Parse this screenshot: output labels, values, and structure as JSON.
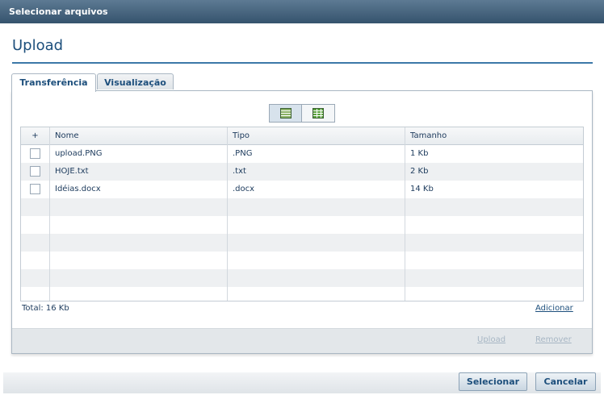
{
  "window": {
    "title": "Selecionar arquivos"
  },
  "page": {
    "title": "Upload"
  },
  "tabs": [
    {
      "label": "Transferência",
      "active": true
    },
    {
      "label": "Visualização",
      "active": false
    }
  ],
  "view_toggle": {
    "list_icon": "list-view-icon",
    "grid_icon": "grid-view-icon",
    "active": "list"
  },
  "table": {
    "columns": [
      "+",
      "Nome",
      "Tipo",
      "Tamanho"
    ],
    "rows": [
      {
        "name": "upload.PNG",
        "type": ".PNG",
        "size": "1 Kb"
      },
      {
        "name": "HOJE.txt",
        "type": ".txt",
        "size": "2 Kb"
      },
      {
        "name": "Idéias.docx",
        "type": ".docx",
        "size": "14 Kb"
      }
    ]
  },
  "summary": {
    "total": "Total: 16 Kb",
    "add_label": "Adicionar"
  },
  "panel_actions": {
    "upload_label": "Upload",
    "remove_label": "Remover"
  },
  "dialog_buttons": {
    "select_label": "Selecionar",
    "cancel_label": "Cancelar"
  },
  "colors": {
    "accent": "#1d4f7c",
    "titlebar": "#3f5d77",
    "disabled_link": "#a7b6c4"
  }
}
